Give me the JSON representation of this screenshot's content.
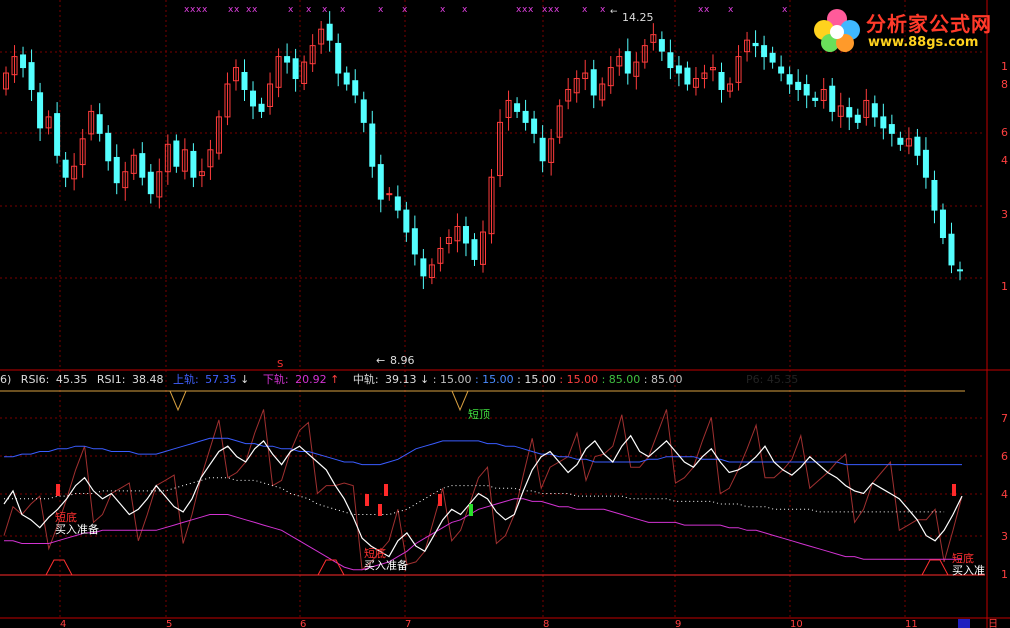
{
  "colors": {
    "background": "#000000",
    "grid": "#7a0000",
    "candle_up": "#ff3c3c",
    "candle_down": "#54ffff",
    "rsi6": "#ffffff",
    "rsi12": "#a03030",
    "upper_band": "#3a5cff",
    "lower_band": "#d233d2",
    "mid_line": "#ffffff"
  },
  "logo": {
    "text": "分析家公式网",
    "url": "www.88gs.com",
    "icon": "flower-icon"
  },
  "price_axis_labels": [
    "1",
    "8",
    "6",
    "4",
    "3",
    "1"
  ],
  "indicator_axis_labels": [
    "7",
    "6",
    "4",
    "3",
    "1"
  ],
  "x_axis_labels": [
    "4",
    "5",
    "6",
    "7",
    "8",
    "9",
    "10",
    "11",
    "日"
  ],
  "price_annotations": {
    "high": "14.25",
    "low": "8.96",
    "low_arrow": "←",
    "high_arrow": "←"
  },
  "signal_marker": "S",
  "indicator_header": {
    "prefix": "6)",
    "rsi6_label": "RSI6:",
    "rsi6_value": "45.35",
    "rsi1_label": "RSI1:",
    "rsi1_value": "38.48",
    "upper_label": "上轨:",
    "upper_value": "57.35",
    "upper_arrow": "↓",
    "lower_label": "下轨:",
    "lower_value": "20.92",
    "lower_arrow": "↑",
    "mid_label": "中轨:",
    "mid_value": "39.13",
    "mid_arrow": "↓",
    "levels": [
      {
        "text": ": 15.00",
        "color": "#c0c0c0"
      },
      {
        "text": ": 15.00",
        "color": "#4a8cff"
      },
      {
        "text": ": 15.00",
        "color": "#e0e0e0"
      },
      {
        "text": ": 15.00",
        "color": "#ff4040"
      },
      {
        "text": ": 85.00",
        "color": "#40c040"
      },
      {
        "text": ": 85.00",
        "color": "#c0c0c0"
      }
    ],
    "ghost": "P6: 45.35"
  },
  "signals": [
    {
      "type": "buy",
      "label_top": "短底",
      "label_bottom": "买入准备"
    },
    {
      "type": "buy",
      "label_top": "短底",
      "label_bottom": "买入准备"
    },
    {
      "type": "sell",
      "label_top": "短顶",
      "label_bottom": ""
    },
    {
      "type": "buy",
      "label_top": "短底",
      "label_bottom": "买入准"
    }
  ],
  "chart_data": [
    {
      "type": "candlestick",
      "title": "",
      "annotations": {
        "high": 14.25,
        "low": 8.96
      },
      "candles_close": [
        13.1,
        13.4,
        13.2,
        12.8,
        12.1,
        12.3,
        11.6,
        11.2,
        11.4,
        11.9,
        12.4,
        12.0,
        11.5,
        11.1,
        11.3,
        11.6,
        11.2,
        10.9,
        11.3,
        11.8,
        11.4,
        11.7,
        11.2,
        11.3,
        11.7,
        12.3,
        12.9,
        13.2,
        12.8,
        12.5,
        12.4,
        12.9,
        13.4,
        13.3,
        13.0,
        13.3,
        13.6,
        13.9,
        13.7,
        13.1,
        12.9,
        12.7,
        12.2,
        11.4,
        10.8,
        10.9,
        10.6,
        10.2,
        9.8,
        9.4,
        9.6,
        9.9,
        10.1,
        10.3,
        10.0,
        9.7,
        10.2,
        11.2,
        12.2,
        12.6,
        12.4,
        12.2,
        12.0,
        11.5,
        11.9,
        12.5,
        12.8,
        13.0,
        13.1,
        12.7,
        12.9,
        13.2,
        13.4,
        13.1,
        13.3,
        13.6,
        13.8,
        13.5,
        13.2,
        13.1,
        12.9,
        13.0,
        13.1,
        13.2,
        12.8,
        12.9,
        13.4,
        13.7,
        13.6,
        13.4,
        13.3,
        13.1,
        12.9,
        12.8,
        12.7,
        12.6,
        12.8,
        12.4,
        12.5,
        12.3,
        12.2,
        12.6,
        12.3,
        12.1,
        12.0,
        11.8,
        11.9,
        11.6,
        11.2,
        10.6,
        10.1,
        9.6,
        9.5
      ]
    },
    {
      "type": "line",
      "title": "",
      "ylim": [
        0,
        100
      ],
      "series": [
        {
          "name": "RSI6",
          "values": [
            42,
            47,
            38,
            36,
            33,
            37,
            40,
            44,
            49,
            52,
            47,
            44,
            46,
            42,
            38,
            40,
            44,
            49,
            45,
            41,
            39,
            44,
            52,
            57,
            62,
            64,
            60,
            58,
            63,
            66,
            61,
            57,
            62,
            64,
            61,
            58,
            55,
            49,
            44,
            37,
            29,
            26,
            24,
            22,
            28,
            31,
            26,
            24,
            30,
            36,
            40,
            38,
            42,
            46,
            44,
            39,
            36,
            38,
            47,
            55,
            60,
            62,
            58,
            54,
            57,
            63,
            66,
            61,
            58,
            64,
            68,
            62,
            60,
            63,
            66,
            62,
            58,
            56,
            60,
            63,
            58,
            54,
            55,
            57,
            60,
            64,
            58,
            55,
            53,
            56,
            60,
            57,
            54,
            52,
            49,
            47,
            46,
            50,
            48,
            46,
            44,
            40,
            36,
            30,
            28,
            32,
            38,
            45
          ]
        },
        {
          "name": "上轨",
          "values": [
            60,
            60,
            61,
            61,
            62,
            62,
            63,
            63,
            64,
            64,
            63,
            63,
            62,
            62,
            62,
            61,
            61,
            61,
            62,
            63,
            64,
            65,
            66,
            67,
            67,
            67,
            66,
            65,
            65,
            64,
            64,
            63,
            63,
            62,
            62,
            61,
            60,
            59,
            58,
            58,
            57,
            57,
            57,
            58,
            59,
            61,
            63,
            64,
            65,
            66,
            66,
            66,
            66,
            66,
            65,
            65,
            64,
            64,
            63,
            62,
            61,
            61,
            60,
            60,
            59,
            59,
            58,
            58,
            58,
            58,
            58,
            58,
            59,
            59,
            60,
            60,
            60,
            60,
            59,
            59,
            59,
            58,
            58,
            58,
            58,
            58,
            58,
            58,
            58,
            58,
            58,
            58,
            58,
            58,
            57,
            57,
            57,
            57,
            57,
            57,
            57,
            57,
            57,
            57,
            57,
            57,
            57,
            57
          ]
        },
        {
          "name": "下轨",
          "values": [
            28,
            28,
            27,
            27,
            27,
            27,
            28,
            29,
            30,
            31,
            31,
            32,
            32,
            32,
            32,
            32,
            32,
            32,
            33,
            34,
            35,
            36,
            37,
            38,
            38,
            38,
            37,
            36,
            35,
            34,
            33,
            32,
            30,
            28,
            26,
            24,
            22,
            20,
            18,
            17,
            17,
            18,
            19,
            20,
            22,
            24,
            27,
            29,
            31,
            33,
            35,
            36,
            38,
            40,
            41,
            42,
            43,
            44,
            44,
            43,
            43,
            42,
            41,
            41,
            40,
            40,
            40,
            40,
            39,
            38,
            37,
            36,
            35,
            35,
            35,
            35,
            34,
            34,
            34,
            34,
            34,
            33,
            33,
            32,
            32,
            31,
            30,
            29,
            28,
            27,
            26,
            25,
            24,
            23,
            22,
            22,
            21,
            21,
            21,
            21,
            21,
            21,
            21,
            21,
            21,
            21,
            21,
            21
          ]
        },
        {
          "name": "中轨",
          "values": [
            44,
            44,
            44,
            44,
            44,
            44,
            45,
            45,
            46,
            46,
            46,
            47,
            47,
            47,
            47,
            47,
            47,
            47,
            47,
            48,
            49,
            50,
            51,
            52,
            52,
            52,
            51,
            51,
            51,
            50,
            49,
            48,
            46,
            45,
            44,
            42,
            41,
            40,
            39,
            38,
            38,
            38,
            38,
            38,
            39,
            40,
            42,
            44,
            46,
            48,
            49,
            49,
            49,
            49,
            49,
            48,
            48,
            48,
            47,
            47,
            46,
            46,
            46,
            46,
            45,
            45,
            45,
            45,
            45,
            45,
            44,
            44,
            44,
            44,
            44,
            43,
            43,
            43,
            43,
            43,
            42,
            42,
            42,
            41,
            41,
            41,
            40,
            40,
            40,
            40,
            40,
            39,
            39,
            39,
            39,
            39,
            39,
            39,
            39,
            39,
            39,
            39,
            39,
            39,
            39,
            39
          ]
        }
      ]
    }
  ]
}
